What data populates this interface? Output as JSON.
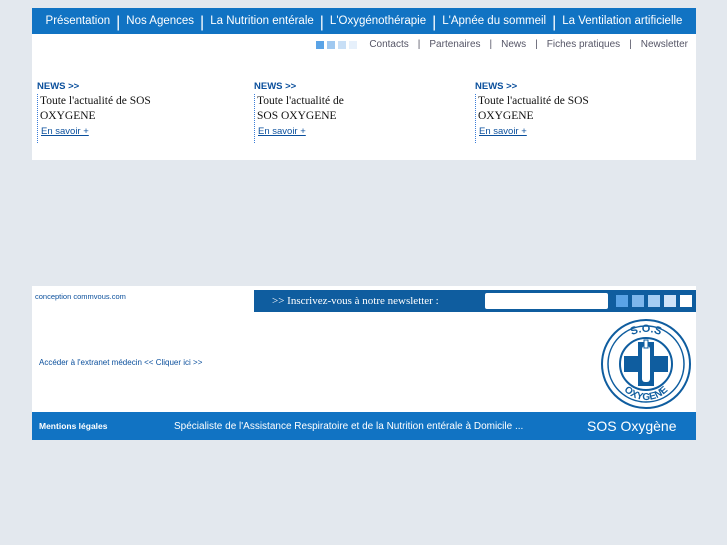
{
  "topnav": {
    "items": [
      "Présentation",
      "Nos Agences",
      "La Nutrition entérale",
      "L'Oxygénothérapie",
      "L'Apnée du sommeil",
      "La Ventilation artificielle"
    ]
  },
  "subnav": {
    "square_colors": [
      "#5aa3e6",
      "#9fc8f0",
      "#c8dff6",
      "#e6f0fb"
    ],
    "links": [
      "Contacts",
      "Partenaires",
      "News",
      "Fiches pratiques",
      "Newsletter"
    ]
  },
  "news": [
    {
      "heading": "NEWS >>",
      "line1": "Toute l'actualité de SOS",
      "line2": "OXYGENE",
      "link": "En savoir +"
    },
    {
      "heading": "NEWS >>",
      "line1": "Toute l'actualité de",
      "line2": "SOS OXYGENE",
      "link": "En savoir +"
    },
    {
      "heading": "NEWS >>",
      "line1": "Toute l'actualité de SOS",
      "line2": "OXYGENE",
      "link": "En savoir +"
    }
  ],
  "footer": {
    "credit": "conception commvous.com",
    "newsletter_label": ">> Inscrivez-vous à notre newsletter :",
    "newsletter_input_value": "",
    "newsletter_square_colors": [
      "#5aa3e6",
      "#7db6ec",
      "#a6cdf3",
      "#cfe3f8",
      "#ffffff"
    ],
    "extranet": "Accéder à l'extranet médecin << Cliquer ici >>",
    "logo_text_top": "S.O.S",
    "logo_text_bottom": "OXYGENE",
    "legal": "Mentions légales",
    "tagline": "Spécialiste de l'Assistance Respiratoire et de la Nutrition entérale à Domicile ...",
    "brand": "SOS Oxygène"
  },
  "colors": {
    "primary_blue": "#1173c3",
    "dark_blue": "#0f5d9f",
    "link_blue": "#0a4f9c",
    "page_bg": "#e3e8ee"
  }
}
